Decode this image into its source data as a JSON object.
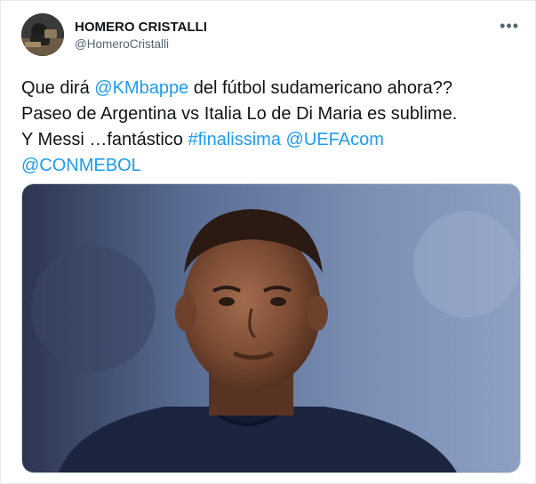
{
  "author": {
    "name": "HOMERO CRISTALLI",
    "handle": "@HomeroCristalli",
    "avatar_icon": "profile-photo"
  },
  "more_icon": "more-dots-icon",
  "more_glyph": "•••",
  "tweet": {
    "line1_pre": "Que dirá ",
    "mention_kmbappe": "@KMbappe",
    "line1_post": " del fútbol sudamericano ahora??",
    "line2": "Paseo de Argentina vs Italia Lo de Di Maria es sublime.",
    "line3_pre": "Y Messi …fantástico ",
    "hashtag": "#finalissima",
    "mention_uefa": "@UEFAcom",
    "mention_conmebol": "@CONMEBOL"
  },
  "colors": {
    "link": "#1d9bf0",
    "text": "#0f1419",
    "secondary": "#536471",
    "jersey": "#1b2540"
  },
  "media": {
    "image_subject": "portrait-of-football-player"
  }
}
